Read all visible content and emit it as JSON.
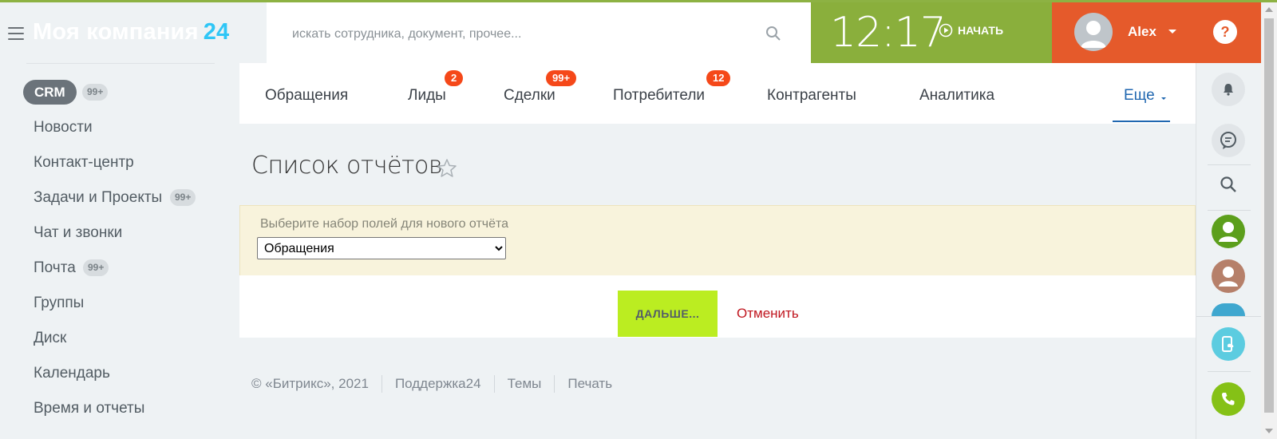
{
  "header": {
    "logo_text": "Моя компания",
    "logo_num": "24",
    "search_placeholder": "искать сотрудника, документ, прочее...",
    "clock": "12:17",
    "start_label": "НАЧАТЬ",
    "user_name": "Alex",
    "help_label": "?"
  },
  "sidebar": {
    "crm": {
      "label": "CRM",
      "counter": "99+"
    },
    "items": [
      {
        "label": "Новости",
        "counter": ""
      },
      {
        "label": "Контакт-центр",
        "counter": ""
      },
      {
        "label": "Задачи и Проекты",
        "counter": "99+"
      },
      {
        "label": "Чат и звонки",
        "counter": ""
      },
      {
        "label": "Почта",
        "counter": "99+"
      },
      {
        "label": "Группы",
        "counter": ""
      },
      {
        "label": "Диск",
        "counter": ""
      },
      {
        "label": "Календарь",
        "counter": ""
      },
      {
        "label": "Время и отчеты",
        "counter": ""
      }
    ]
  },
  "tabs": [
    {
      "label": "Обращения",
      "badge": ""
    },
    {
      "label": "Лиды",
      "badge": "2"
    },
    {
      "label": "Сделки",
      "badge": "99+"
    },
    {
      "label": "Потребители",
      "badge": "12"
    },
    {
      "label": "Контрагенты",
      "badge": ""
    },
    {
      "label": "Аналитика",
      "badge": ""
    },
    {
      "label": "Еще",
      "badge": ""
    }
  ],
  "main": {
    "title": "Список отчётов",
    "field_label": "Выберите набор полей для нового отчёта",
    "select_value": "Обращения",
    "next_label": "ДАЛЬШЕ...",
    "cancel_label": "Отменить"
  },
  "footer": {
    "copyright": "© «Битрикс», 2021",
    "links": [
      "Поддержка24",
      "Темы",
      "Печать"
    ]
  },
  "colors": {
    "accent_green": "#8aaf3c",
    "accent_orange": "#e55a2b",
    "badge_red": "#f54819",
    "next_button": "#bbed21",
    "link_blue": "#2067b0"
  }
}
